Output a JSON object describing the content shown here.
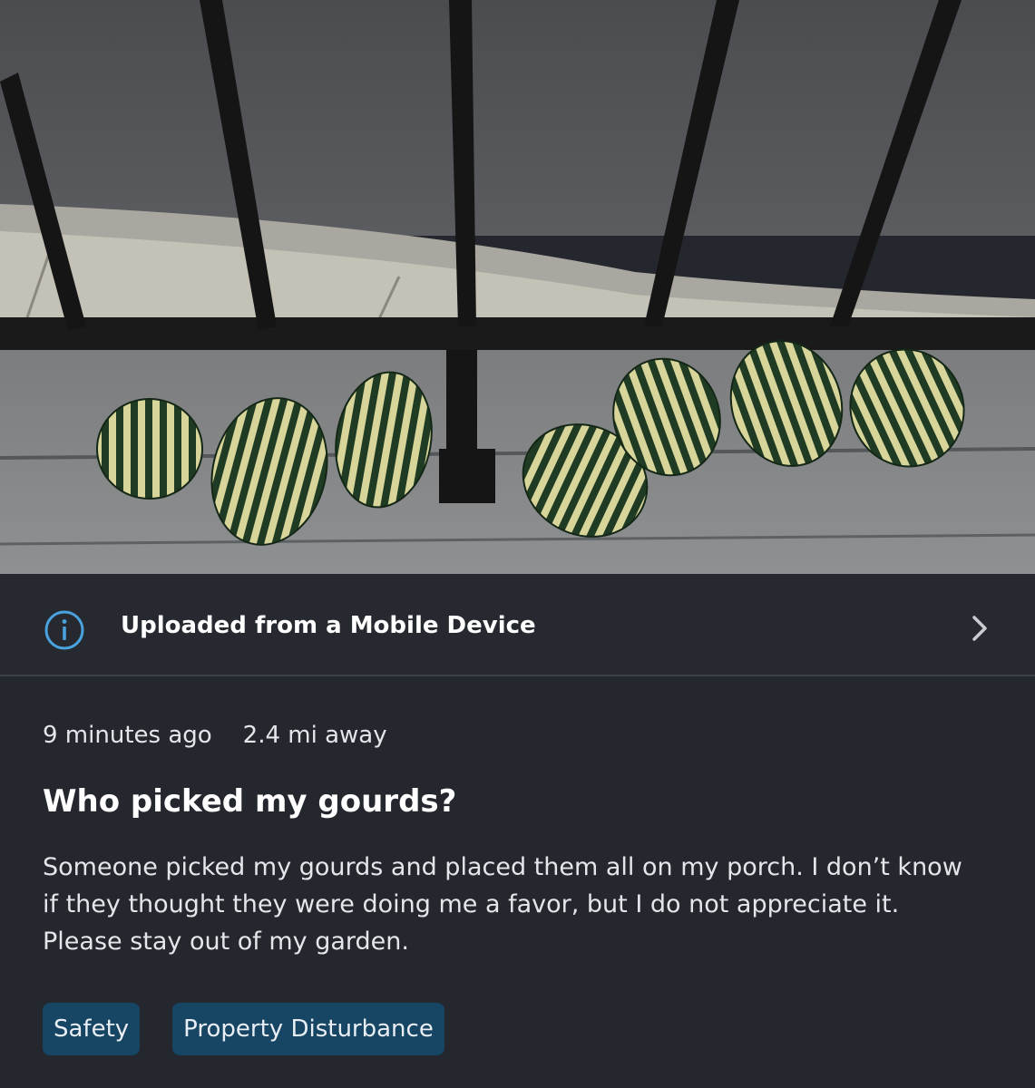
{
  "info": {
    "label": "Uploaded from a Mobile Device",
    "icon": "info-icon",
    "accent": "#4aa3df"
  },
  "post": {
    "time": "9 minutes ago",
    "distance": "2.4 mi away",
    "title": "Who picked my gourds?",
    "body": "Someone picked my gourds and placed them all on my porch. I don’t know if they thought they were doing me a favor, but I do not appreciate it. Please stay out of my garden."
  },
  "tags": [
    {
      "label": "Safety"
    },
    {
      "label": "Property Disturbance"
    }
  ],
  "colors": {
    "background": "#24272d",
    "tag_bg": "#174564"
  }
}
